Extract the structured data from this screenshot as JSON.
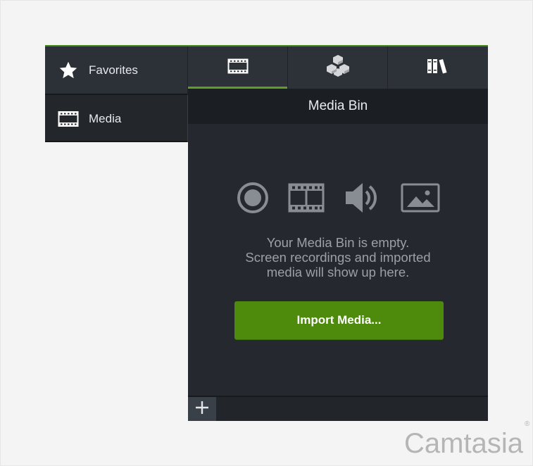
{
  "sidebar": {
    "items": [
      {
        "label": "Favorites",
        "icon": "star-icon"
      },
      {
        "label": "Media",
        "icon": "film-icon"
      }
    ]
  },
  "tabs": [
    {
      "icon": "film-icon",
      "active": true
    },
    {
      "icon": "cubes-icon",
      "active": false
    },
    {
      "icon": "library-icon",
      "active": false
    }
  ],
  "bin": {
    "title": "Media Bin",
    "empty_line1": "Your Media Bin is empty.",
    "empty_line2": "Screen recordings and imported",
    "empty_line3": "media will show up here.",
    "import_label": "Import Media...",
    "media_type_icons": [
      "record-icon",
      "film-icon",
      "audio-icon",
      "image-icon"
    ]
  },
  "footer": {
    "add_symbol": "+"
  },
  "brand": {
    "name": "Camtasia",
    "mark": "®"
  },
  "colors": {
    "accent": "#4e8a0b",
    "panel": "#25292f",
    "header": "#1b1e22",
    "rail": "#2c3138"
  }
}
